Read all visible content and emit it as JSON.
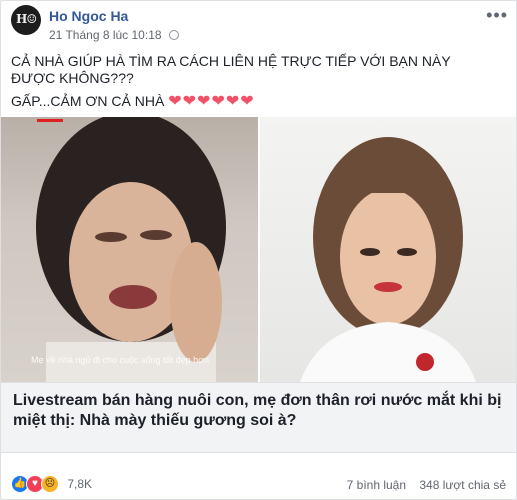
{
  "post": {
    "author": "Ho Ngoc Ha",
    "timestamp": "21 Tháng 8 lúc 10:18",
    "text_line1": "CẢ NHÀ GIÚP HÀ TÌM RA CÁCH LIÊN HỆ TRỰC TIẾP VỚI BẠN NÀY ĐƯỢC KHÔNG???",
    "text_line2": "GẤP...CẢM ƠN CẢ NHÀ",
    "hearts": "❤❤❤❤❤❤"
  },
  "media": {
    "overlay": "Mẹ về nhà ngủ đi cho cuộc sống tốt đẹp hơn"
  },
  "link": {
    "title": "Livestream bán hàng nuôi con, mẹ đơn thân rơi nước mắt khi bị miệt thị: Nhà mày thiếu gương soi à?"
  },
  "footer": {
    "reaction_count": "7,8K",
    "comments": "7 bình luận",
    "shares": "348 lượt chia sẻ"
  },
  "icons": [
    "more-icon",
    "globe-icon",
    "like-icon",
    "love-icon",
    "sad-icon"
  ],
  "colors": {
    "author": "#365899",
    "heart": "#f25268",
    "like": "#1877f2",
    "love": "#f33e58",
    "sad": "#f7b125"
  }
}
